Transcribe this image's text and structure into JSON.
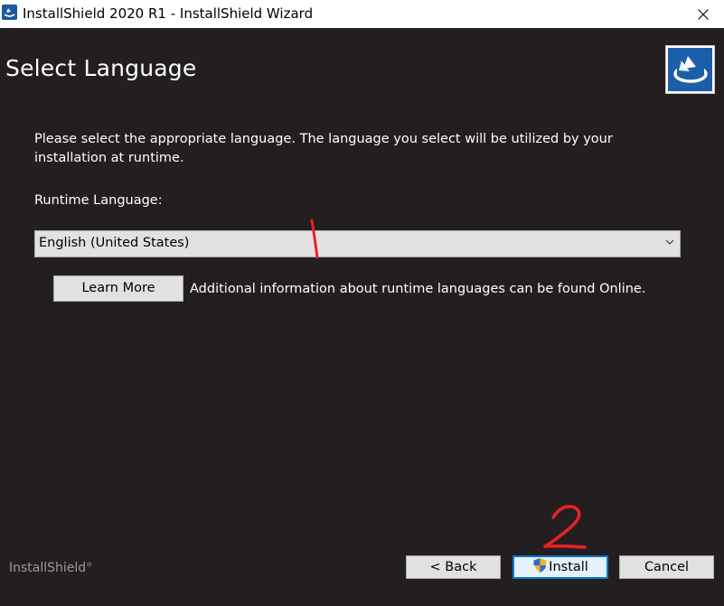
{
  "window": {
    "title": "InstallShield 2020 R1 - InstallShield Wizard"
  },
  "header": {
    "title": "Select Language"
  },
  "content": {
    "description": "Please select the appropriate language. The language you select will be utilized by your installation at runtime.",
    "runtime_language_label": "Runtime Language:",
    "runtime_language_value": "English (United States)",
    "learn_more_label": "Learn More",
    "learn_more_description": "Additional information about runtime languages can be found Online."
  },
  "annotations": {
    "step1": "1",
    "step2": "2"
  },
  "footer": {
    "brand": "InstallShield",
    "back_label": "< Back",
    "install_label": "Install",
    "cancel_label": "Cancel"
  },
  "colors": {
    "background": "#231f20",
    "annotation": "#e8202a",
    "accent": "#0078d7",
    "logo": "#1d5ea8"
  },
  "icons": [
    "app-icon",
    "close-icon",
    "installshield-logo-icon",
    "chevron-down-icon",
    "uac-shield-icon"
  ]
}
